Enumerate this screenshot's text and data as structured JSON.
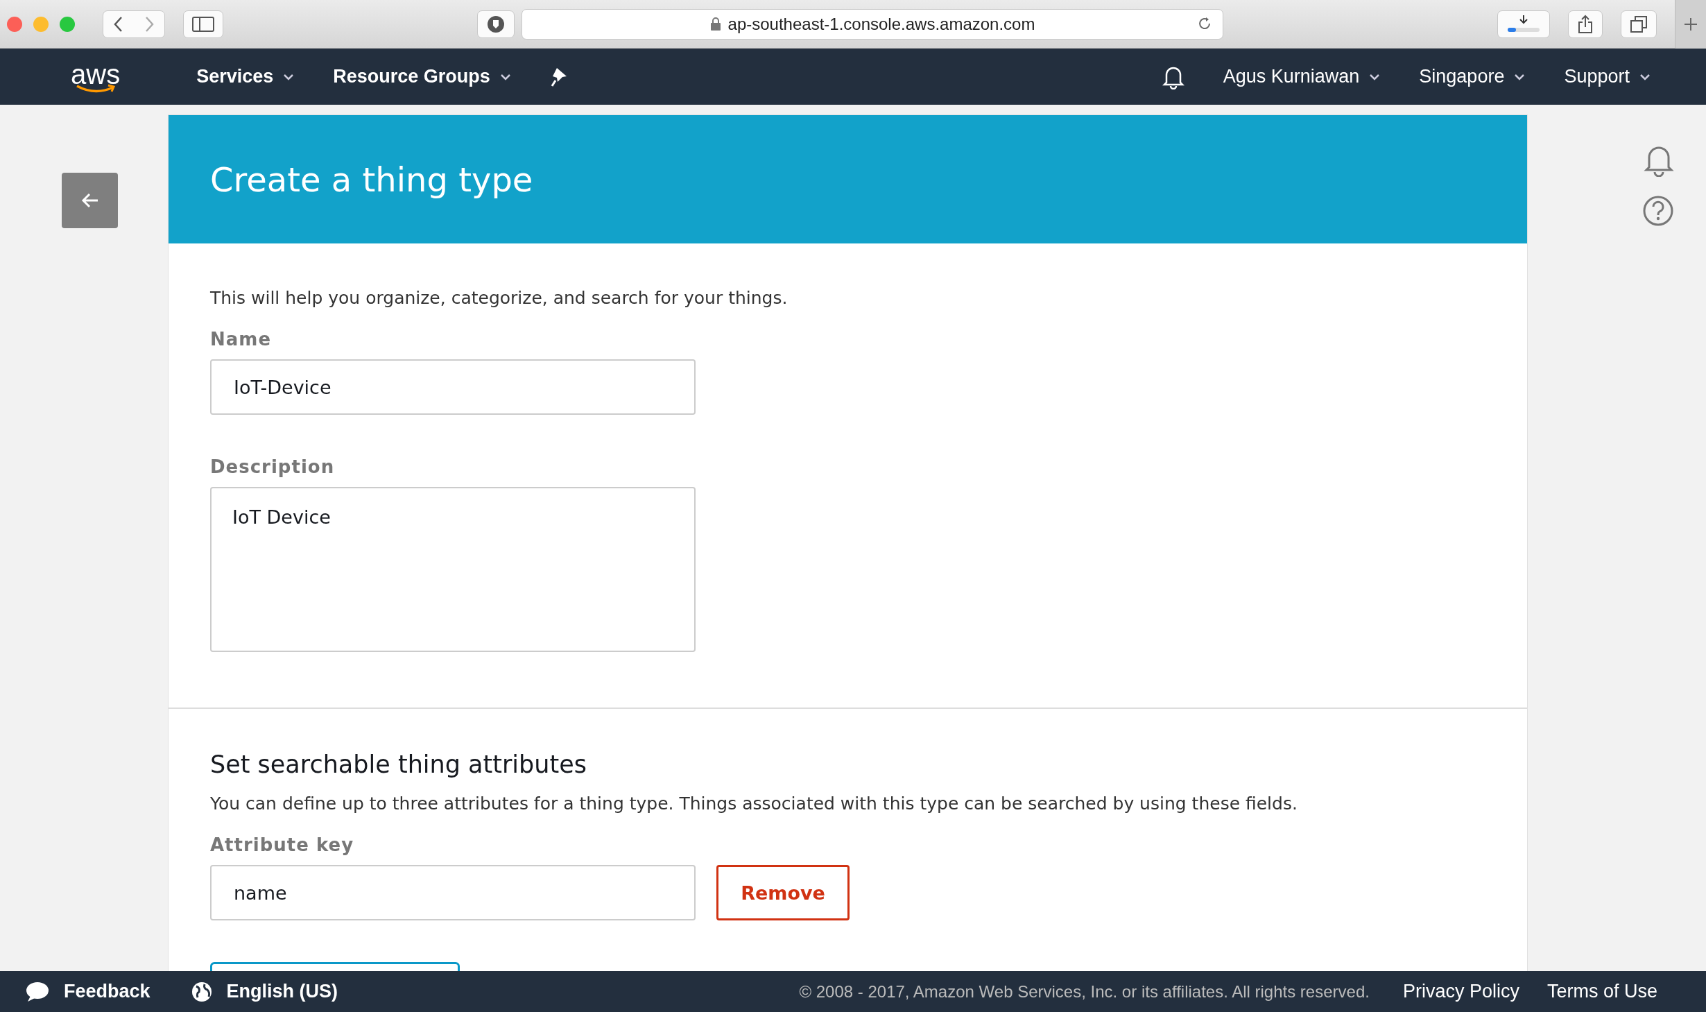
{
  "browser": {
    "url": "ap-southeast-1.console.aws.amazon.com"
  },
  "nav": {
    "logo": "aws",
    "menus": [
      {
        "label": "Services"
      },
      {
        "label": "Resource Groups"
      }
    ],
    "right_menus": [
      {
        "label": "Agus Kurniawan"
      },
      {
        "label": "Singapore"
      },
      {
        "label": "Support"
      }
    ]
  },
  "page": {
    "title": "Create a thing type",
    "intro": "This will help you organize, categorize, and search for your things.",
    "name": {
      "label": "Name",
      "value": "IoT-Device"
    },
    "description": {
      "label": "Description",
      "value": "IoT Device"
    },
    "attributes": {
      "heading": "Set searchable thing attributes",
      "text": "You can define up to three attributes for a thing type. Things associated with this type can be searched by using these fields.",
      "label": "Attribute key",
      "value": "name",
      "remove_button": "Remove"
    }
  },
  "footer": {
    "feedback": "Feedback",
    "language": "English (US)",
    "copyright": "© 2008 - 2017, Amazon Web Services, Inc. or its affiliates. All rights reserved.",
    "links": [
      "Privacy Policy",
      "Terms of Use"
    ]
  }
}
